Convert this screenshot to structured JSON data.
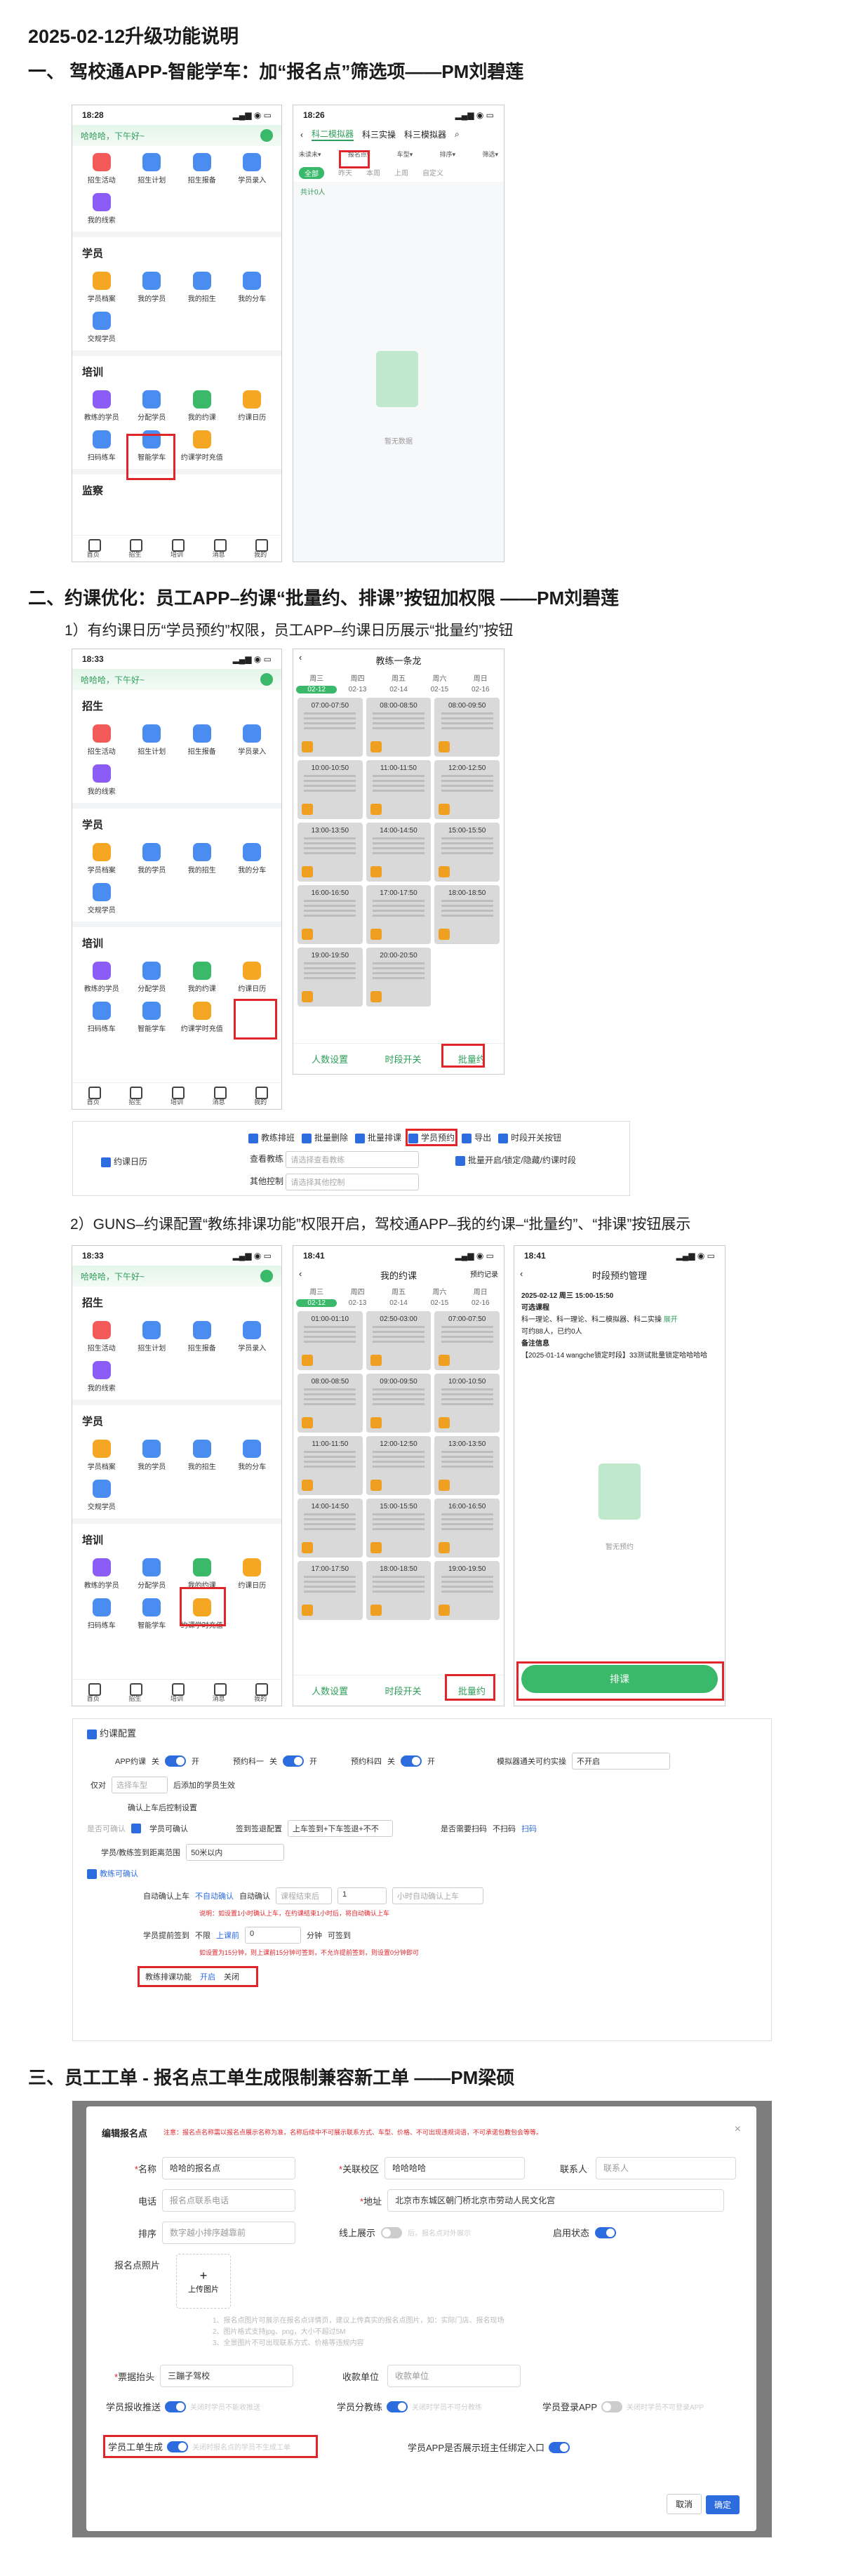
{
  "doc_title": "2025-02-12升级功能说明",
  "s1": {
    "title": "一、 驾校通APP-智能学车：加“报名点”筛选项——PM刘碧莲",
    "phoneA": {
      "time": "18:28",
      "greeting": "哈哈哈，下午好~",
      "top_items": [
        "招生活动",
        "招生计划",
        "招生报备",
        "学员录入"
      ],
      "extra": "我的线索",
      "sec_student": "学员",
      "student_items": [
        "学员档案",
        "我的学员",
        "我的招生",
        "我的分车"
      ],
      "student_extra": "交规学员",
      "sec_train": "培训",
      "train_items": [
        "教练的学员",
        "分配学员",
        "我的约课",
        "约课日历"
      ],
      "train_row2": [
        "扫码练车",
        "智能学车",
        "约课学时充值"
      ],
      "sec_monitor": "监察",
      "tabs": [
        "首页",
        "招生",
        "培训",
        "消息",
        "我的"
      ]
    },
    "phoneB": {
      "time": "18:26",
      "tabs": [
        "科二模拟器",
        "科三实操",
        "科三模拟器"
      ],
      "filters": [
        "未读未▾",
        "报名点▾",
        "车型▾",
        "排序▾",
        "筛选▾"
      ],
      "subtabs": [
        "全部",
        "昨天",
        "本周",
        "上周",
        "自定义"
      ],
      "count": "共计0人",
      "empty": "暂无数据"
    }
  },
  "s2": {
    "title": "二、约课优化：员工APP–约课“批量约、排课”按钮加权限 ——PM刘碧莲",
    "sub1": "1）有约课日历“学员预约”权限，员工APP–约课日历展示“批量约”按钮",
    "phoneC": {
      "time": "18:33",
      "greeting": "哈哈哈，下午好~",
      "sec_enroll": "招生"
    },
    "cal1": {
      "title": "教练一条龙",
      "days": [
        "周三",
        "周四",
        "周五",
        "周六",
        "周日"
      ],
      "dates": [
        "02-12",
        "02-13",
        "02-14",
        "02-15",
        "02-16"
      ],
      "slots": [
        "07:00-07:50",
        "08:00-08:50",
        "08:00-09:50",
        "10:00-10:50",
        "11:00-11:50",
        "12:00-12:50",
        "13:00-13:50",
        "14:00-14:50",
        "15:00-15:50",
        "16:00-16:50",
        "17:00-17:50",
        "18:00-18:50",
        "19:00-19:50",
        "20:00-20:50"
      ],
      "bottom": [
        "人数设置",
        "时段开关",
        "批量约"
      ]
    },
    "perm": {
      "label": "约课日历",
      "checks": [
        "教练排班",
        "批量删除",
        "批量排课",
        "学员预约",
        "导出",
        "时段开关按钮"
      ],
      "row2_label": "查看教练",
      "row2_ph": "请选择查看教练",
      "row2_check": "批量开启/锁定/隐藏/约课时段",
      "row3_label": "其他控制",
      "row3_ph": "请选择其他控制"
    },
    "sub2": "2）GUNS–约课配置“教练排课功能”权限开启，驾校通APP–我的约课–“批量约”、“排课”按钮展示",
    "phoneD": {
      "time": "18:33"
    },
    "cal2": {
      "time": "18:41",
      "title": "我的约课",
      "extra": "预约记录",
      "slots": [
        "01:00-01:10",
        "02:50-03:00",
        "07:00-07:50",
        "08:00-08:50",
        "09:00-09:50",
        "10:00-10:50",
        "11:00-11:50",
        "12:00-12:50",
        "13:00-13:50",
        "14:00-14:50",
        "15:00-15:50",
        "16:00-16:50",
        "17:00-17:50",
        "18:00-18:50",
        "19:00-19:50"
      ],
      "bottom": [
        "人数设置",
        "时段开关",
        "批量约"
      ]
    },
    "mgr": {
      "time": "18:41",
      "title": "时段预约管理",
      "date": "2025-02-12 周三 15:00-15:50",
      "course_label": "可选课程",
      "course": "科一理论、科一理论、科二模拟器、科二实操",
      "more": "展开",
      "count": "可约88人，已约0人",
      "note_label": "备注信息",
      "note": "【2025-01-14 wangche锁定时段】33测试批量锁定哈哈哈哈",
      "empty": "暂无预约",
      "button": "排课"
    },
    "guns": {
      "title": "约课配置",
      "r1": [
        "APP约课",
        "关",
        "开",
        "预约科一",
        "关",
        "开",
        "预约科四",
        "关",
        "开",
        "模拟器通关可约实操",
        "不开启"
      ],
      "r2": [
        "仅对",
        "选择车型",
        "后添加的学员生效"
      ],
      "r3": "确认上车后控制设置",
      "r4": [
        "是否可确认",
        "学员可确认",
        "签到签退配置",
        "上车签到+下车签退+不不",
        "是否需要扫码",
        "不扫码",
        "扫码"
      ],
      "r5": [
        "学员/教练签到距离范围",
        "50米以内"
      ],
      "r6": "教练可确认",
      "r7": [
        "自动确认上车",
        "不自动确认",
        "自动确认",
        "课程结束后",
        "1",
        "小时自动确认上车"
      ],
      "r7_note": "说明：如设置1小时确认上车，在约课结束1小时后，将自动确认上车",
      "r8": [
        "学员提前签到",
        "不限",
        "上课前",
        "0",
        "分钟",
        "可签到"
      ],
      "r8_note": "如设置为15分钟，则上课前15分钟可签到，不允许提前签到，则设置0分钟即可",
      "r9": [
        "教练排课功能",
        "开启",
        "关闭"
      ]
    }
  },
  "s3": {
    "title": "三、员工工单 - 报名点工单生成限制兼容新工单 ——PM梁硕",
    "dialog_title": "编辑报名点",
    "notice": "注意：报名点名称需以报名点展示名称为准，名称后续中不可展示联系方式、车型、价格、不可出现违规词语，不可承诺包教包会等等。",
    "f_name_l": "名称",
    "f_name_v": "哈哈的报名点",
    "f_school_l": "关联校区",
    "f_school_v": "哈哈哈哈",
    "f_contact_l": "联系人",
    "f_contact_ph": "联系人",
    "f_phone_l": "电话",
    "f_phone_ph": "报名点联系电话",
    "f_addr_l": "地址",
    "f_addr_v": "北京市东城区朝门桥北京市劳动人民文化宫",
    "f_sort_l": "排序",
    "f_sort_ph": "数字越小排序越靠前",
    "f_online_l": "线上展示",
    "f_online_t": "后，报名点对外展示",
    "f_enable_l": "启用状态",
    "f_enable_t": "开",
    "f_photo_l": "报名点照片",
    "f_upload": "上传图片",
    "tips": [
      "1、报名点图片可展示在报名点详情页，建议上传真实的报名点图片，如：实际门店、报名现场",
      "2、图片格式支持jpg、png，大小不超过5M",
      "3、全景图片不可出现联系方式、价格等违规内容"
    ],
    "f_receipt_l": "票据抬头",
    "f_receipt_v": "三蹦子驾校",
    "f_unit_l": "收款单位",
    "f_unit_ph": "收款单位",
    "f_collect_l": "学员报收推送",
    "f_collect_t": "关闭时学员不能收推送",
    "f_allot_l": "学员分教练",
    "f_allot_t": "关闭时学员不可分教练",
    "f_login_l": "学员登录APP",
    "f_login_t": "关闭时学员不可登录APP",
    "f_ticket_l": "学员工单生成",
    "f_ticket_t": "关闭时报名点的学员不生成工单",
    "f_show_l": "学员APP是否展示班主任绑定入口",
    "f_show_t": "开",
    "btn_cancel": "取消",
    "btn_ok": "确定"
  }
}
